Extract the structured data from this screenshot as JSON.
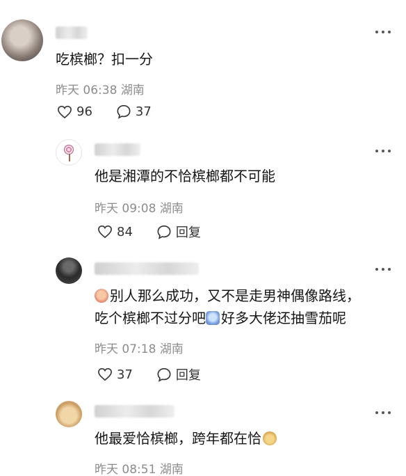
{
  "comments": [
    {
      "text": "吃槟榔？扣一分",
      "time": "昨天 06:38",
      "location": "湖南",
      "likes": "96",
      "replies": "37"
    },
    {
      "text": "他是湘潭的不恰槟榔都不可能",
      "time": "昨天 09:08",
      "location": "湖南",
      "likes": "84",
      "reply_label": "回复"
    },
    {
      "line1": "别人那么成功，又不是走男神偶像路线，",
      "line2a": "吃个槟榔不过分吧",
      "line2b": "好多大佬还抽雪茄呢",
      "time": "昨天 07:18",
      "location": "湖南",
      "likes": "37",
      "reply_label": "回复"
    },
    {
      "text": "他最爱恰槟榔，跨年都在恰",
      "time": "昨天 08:51",
      "location": "湖南"
    }
  ],
  "icons": {
    "like": "heart-outline-icon",
    "comment": "speech-bubble-icon",
    "more": "more-dots-icon",
    "emoji_cry": "crying-emoji-icon",
    "emoji_lol": "laughing-tears-emoji-icon",
    "emoji_dog": "dog-face-emoji-icon"
  }
}
